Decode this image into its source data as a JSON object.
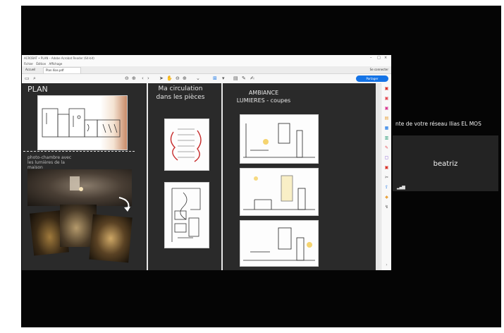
{
  "window": {
    "title": "ACROBAT • PLAN – Adobe Acrobat Reader (64-bit)",
    "menu": [
      "Fichier",
      "Édition",
      "Affichage"
    ],
    "tabs": [
      "Accueil",
      "Plan Ilias.pdf"
    ],
    "top_right": "Se connecter",
    "share_button": "Partager"
  },
  "document": {
    "plan": "PLAN",
    "circulation": "Ma circulation dans les pièces",
    "ambiance_line1": "AMBIANCE",
    "ambiance_line2": "LUMIERES - coupes",
    "photo_caption": "photo-chambre avec les lumières de la maison"
  },
  "meeting": {
    "scrolling_text": "nte de votre réseau Ilias EL MOS",
    "participant_name": "beatriz"
  },
  "colors": {
    "accent": "#1473e6",
    "board_bg": "#2a2a2a",
    "tile_bg": "#232323"
  }
}
